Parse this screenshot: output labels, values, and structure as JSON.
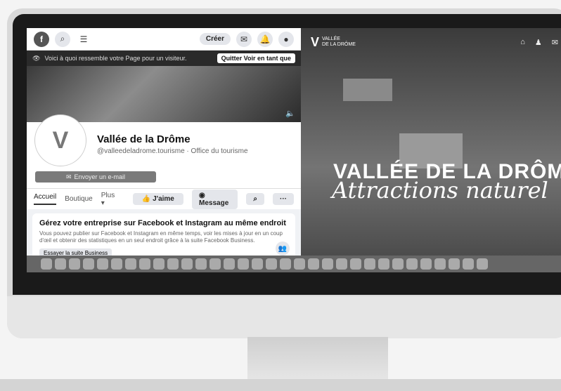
{
  "facebook": {
    "create_label": "Créer",
    "banner_text": "Voici à quoi ressemble votre Page pour un visiteur.",
    "banner_button": "Quitter Voir en tant que",
    "page_name": "Vallée de la Drôme",
    "page_handle": "@valleedeladrome.tourisme · Office du tourisme",
    "email_button": "Envoyer un e-mail",
    "tabs": [
      "Accueil",
      "Boutique",
      "Plus ▾"
    ],
    "like_label": "J'aime",
    "message_label": "Message",
    "more_label": "···",
    "card": {
      "title": "Gérez votre entreprise sur Facebook et Instagram au même endroit",
      "body": "Vous pouvez publier sur Facebook et Instagram en même temps, voir les mises à jour en un coup d'œil et obtenir des statistiques en un seul endroit grâce à la suite Facebook Business.",
      "button": "Essayer la suite Business"
    }
  },
  "site": {
    "logo_line1": "VALLÉE",
    "logo_line2": "DE LA DRÔME",
    "hero_title": "VALLÉE DE LA DRÔM",
    "hero_subtitle": "Attractions naturel"
  }
}
